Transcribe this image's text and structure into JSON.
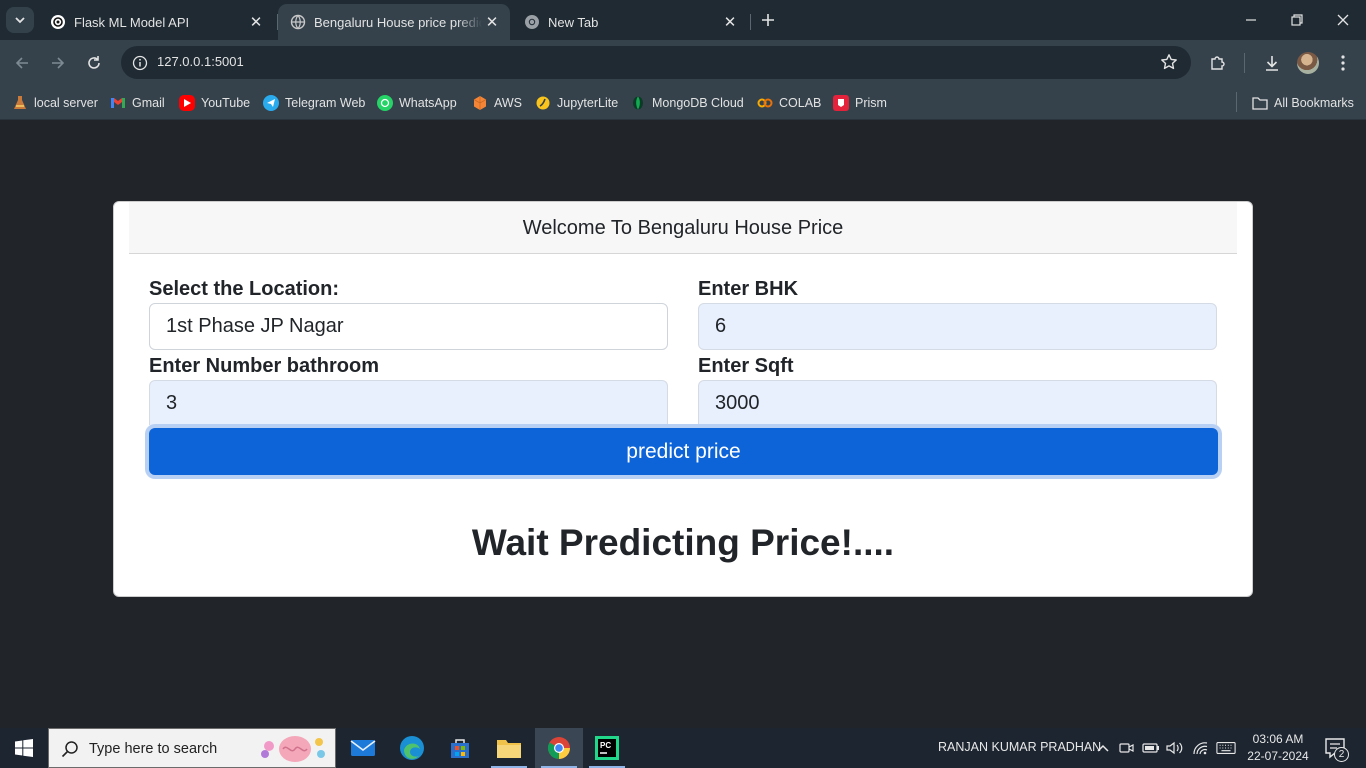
{
  "browser": {
    "tabs": [
      {
        "title": "Flask ML Model API",
        "active": false
      },
      {
        "title": "Bengaluru House price prediction",
        "active": true
      },
      {
        "title": "New Tab",
        "active": false
      }
    ],
    "url": "127.0.0.1:5001",
    "bookmarks": [
      {
        "label": "local server",
        "icon": "flask-icon"
      },
      {
        "label": "Gmail",
        "icon": "gmail-icon"
      },
      {
        "label": "YouTube",
        "icon": "youtube-icon"
      },
      {
        "label": "Telegram Web",
        "icon": "telegram-icon"
      },
      {
        "label": "WhatsApp",
        "icon": "whatsapp-icon"
      },
      {
        "label": "AWS",
        "icon": "aws-icon"
      },
      {
        "label": "JupyterLite",
        "icon": "jupyter-icon"
      },
      {
        "label": "MongoDB Cloud",
        "icon": "mongodb-icon"
      },
      {
        "label": "COLAB",
        "icon": "colab-icon"
      },
      {
        "label": "Prism",
        "icon": "prism-icon"
      }
    ],
    "all_bookmarks_label": "All Bookmarks"
  },
  "page": {
    "header": "Welcome To Bengaluru House Price",
    "location": {
      "label": "Select the Location:",
      "value": "1st Phase JP Nagar"
    },
    "bhk": {
      "label": "Enter BHK",
      "value": "6"
    },
    "bath": {
      "label": "Enter Number bathroom",
      "value": "3"
    },
    "sqft": {
      "label": "Enter Sqft",
      "value": "3000"
    },
    "predict_button": "predict price",
    "result": "Wait Predicting Price!...."
  },
  "taskbar": {
    "search_placeholder": "Type here to search",
    "user": "RANJAN KUMAR PRADHAN",
    "time": "03:06 AM",
    "date": "22-07-2024",
    "notifications": "2"
  },
  "colors": {
    "page_bg": "#212529",
    "button": "#0d64d8",
    "autofill": "#e8f0fe"
  }
}
